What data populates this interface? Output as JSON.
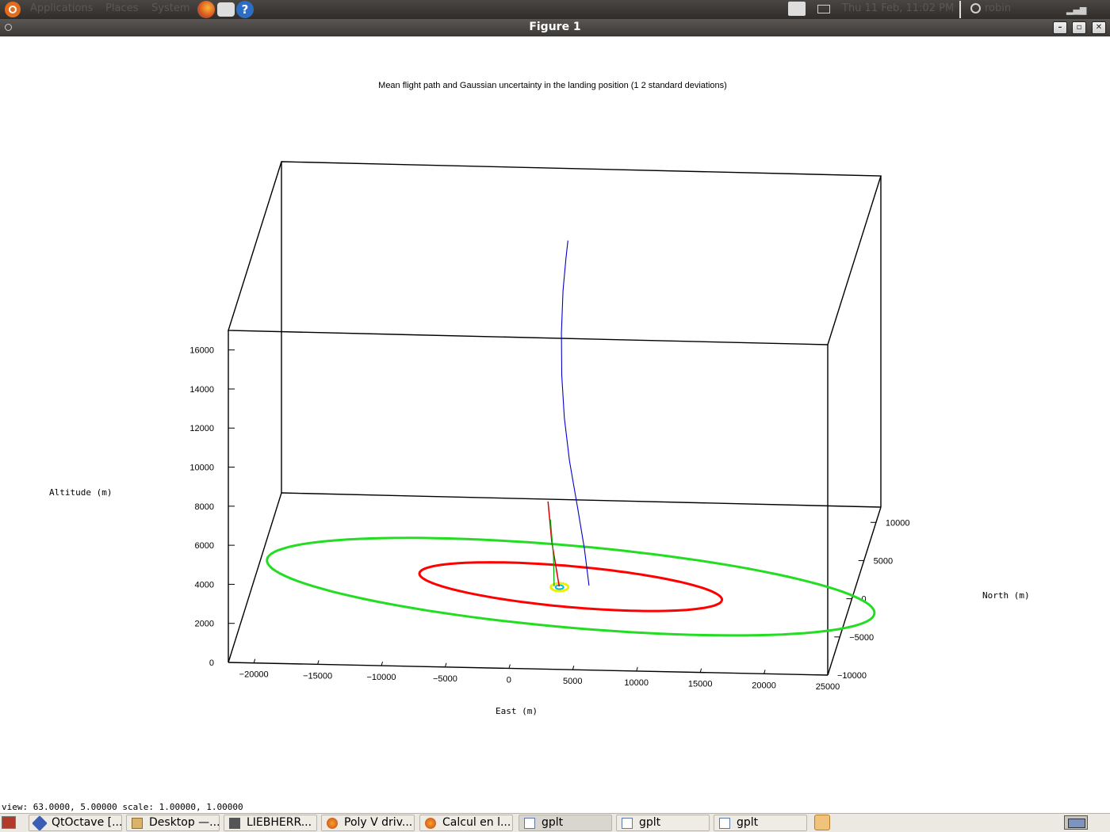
{
  "top_panel": {
    "menus": [
      "Applications",
      "Places",
      "System"
    ],
    "clock": "Thu 11 Feb, 11:02 PM",
    "user": "robin",
    "launchers": [
      "firefox-icon",
      "mail-icon",
      "help-icon"
    ],
    "help_glyph": "?"
  },
  "window": {
    "title": "Figure 1"
  },
  "chart_data": {
    "type": "line",
    "title": "Mean flight path and Gaussian uncertainty in the landing position (1  2 standard deviations)",
    "xlabel": "East (m)",
    "ylabel": "North (m)",
    "zlabel": "Altitude (m)",
    "xlim": [
      -22000,
      25000
    ],
    "ylim": [
      -10000,
      12000
    ],
    "zlim": [
      0,
      17000
    ],
    "x_ticks": [
      "-20000",
      "-15000",
      "-10000",
      "-5000",
      "0",
      "5000",
      "10000",
      "15000",
      "20000",
      "25000"
    ],
    "y_ticks": [
      "-10000",
      "-5000",
      "0",
      "5000",
      "10000"
    ],
    "z_ticks": [
      "0",
      "2000",
      "4000",
      "6000",
      "8000",
      "10000",
      "12000",
      "14000",
      "16000"
    ],
    "view": {
      "rot_x": 63,
      "rot_z": 5
    },
    "series": [
      {
        "color": "#0000cc",
        "kind": "mean flight path"
      },
      {
        "color": "#dd0000",
        "kind": "trajectory"
      },
      {
        "color": "#00aa00",
        "kind": "trajectory"
      },
      {
        "color": "#ff0000",
        "kind": "1 standard deviation ellipse"
      },
      {
        "color": "#22dd22",
        "kind": "2 standard deviation ellipse"
      },
      {
        "color": "#eeee00",
        "kind": "landing marker"
      },
      {
        "color": "#00bbdd",
        "kind": "landing marker"
      }
    ]
  },
  "status_bar": {
    "text": "view:  63.0000,  5.00000   scale:  1.00000,  1.00000"
  },
  "taskbar": {
    "tasks": [
      {
        "label": "QtOctave [...",
        "icon": "octave-icon"
      },
      {
        "label": "Desktop —...",
        "icon": "folder-icon"
      },
      {
        "label": "LIEBHERR...",
        "icon": "film-icon"
      },
      {
        "label": "Poly V driv...",
        "icon": "firefox-icon"
      },
      {
        "label": "Calcul en l...",
        "icon": "firefox-icon"
      },
      {
        "label": "gplt",
        "icon": "window-icon"
      },
      {
        "label": "gplt",
        "icon": "window-icon"
      },
      {
        "label": "gplt",
        "icon": "window-icon"
      }
    ]
  }
}
